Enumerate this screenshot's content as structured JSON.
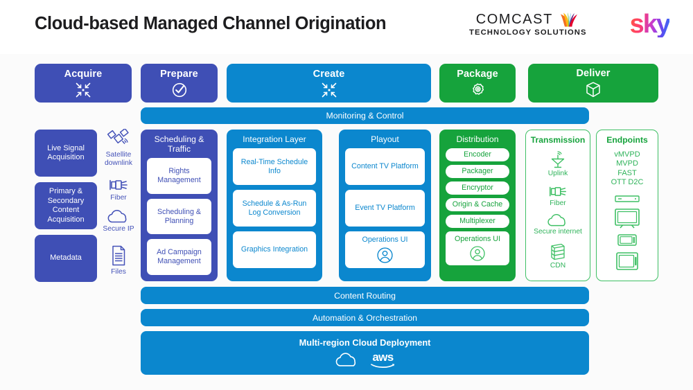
{
  "header": {
    "title": "Cloud-based Managed Channel Origination",
    "comcast_logo": {
      "word": "COMCAST",
      "sub": "TECHNOLOGY SOLUTIONS",
      "icon": "nbc-peacock-icon"
    },
    "sky_logo": {
      "text": "sky"
    }
  },
  "colors": {
    "purple": "#3f4fb5",
    "blue": "#0b87ce",
    "green": "#16a33c",
    "green_outline": "#3dbf63",
    "background": "#fbfbfb"
  },
  "stages": [
    {
      "label": "Acquire",
      "icon": "converge-arrows-icon",
      "color": "#3f4fb5"
    },
    {
      "label": "Prepare",
      "icon": "check-circle-icon",
      "color": "#3f4fb5"
    },
    {
      "label": "Create",
      "icon": "converge-arrows-icon",
      "color": "#0b87ce"
    },
    {
      "label": "Package",
      "icon": "gear-icon",
      "color": "#16a33c"
    },
    {
      "label": "Deliver",
      "icon": "box-3d-icon",
      "color": "#16a33c"
    }
  ],
  "bars": {
    "monitoring": "Monitoring & Control",
    "content_routing": "Content Routing",
    "automation": "Automation & Orchestration",
    "cloud": {
      "title": "Multi-region Cloud Deployment",
      "cloud_icon": "cloud-icon",
      "aws_label": "aws"
    }
  },
  "acquire_column": {
    "boxes": [
      "Live Signal Acquisition",
      "Primary & Secondary Content Acquisition",
      "Metadata"
    ],
    "icons": [
      {
        "label": "Satellite downlink",
        "icon": "satellite-icon"
      },
      {
        "label": "Fiber",
        "icon": "fiber-connector-icon"
      },
      {
        "label": "Secure IP",
        "icon": "cloud-icon"
      },
      {
        "label": "Files",
        "icon": "document-icon"
      }
    ]
  },
  "panels": [
    {
      "id": "scheduling-traffic",
      "title": "Scheduling & Traffic",
      "color": "#3f4fb5",
      "items": [
        "Rights Management",
        "Scheduling & Planning",
        "Ad Campaign Management"
      ]
    },
    {
      "id": "integration-layer",
      "title": "Integration Layer",
      "color": "#0b87ce",
      "items": [
        "Real-Time Schedule Info",
        "Schedule & As-Run Log Conversion",
        "Graphics Integration"
      ]
    },
    {
      "id": "playout",
      "title": "Playout",
      "color": "#0b87ce",
      "items": [
        "Content TV Platform",
        "Event TV Platform",
        "Operations UI"
      ],
      "last_item_icon": "person-icon"
    },
    {
      "id": "distribution",
      "title": "Distribution",
      "color": "#16a33c",
      "items": [
        "Encoder",
        "Packager",
        "Encryptor",
        "Origin & Cache",
        "Multiplexer",
        "Operations UI"
      ],
      "last_item_icon": "person-icon"
    }
  ],
  "transmission": {
    "title": "Transmission",
    "items": [
      {
        "label": "Uplink",
        "icon": "satellite-dish-icon"
      },
      {
        "label": "Fiber",
        "icon": "fiber-connector-icon"
      },
      {
        "label": "Secure internet",
        "icon": "cloud-icon"
      },
      {
        "label": "CDN",
        "icon": "server-rack-icon"
      }
    ]
  },
  "endpoints": {
    "title": "Endpoints",
    "labels": [
      "vMVPD",
      "MVPD",
      "FAST",
      "OTT D2C"
    ],
    "devices": [
      "set-top-box-icon",
      "television-icon",
      "smartphone-icon",
      "tablet-icon"
    ]
  }
}
